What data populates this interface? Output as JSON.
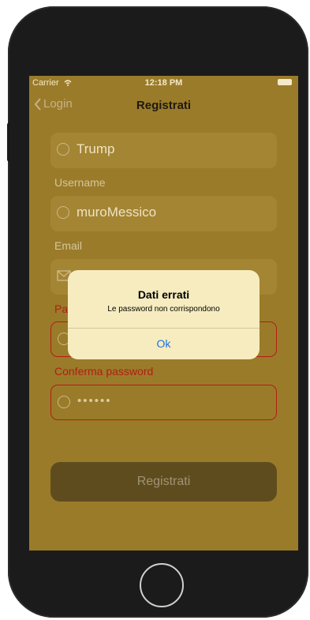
{
  "status": {
    "carrier": "Carrier",
    "time": "12:18 PM"
  },
  "nav": {
    "back_label": "Login",
    "title": "Registrati"
  },
  "fields": {
    "lastname_value": "Trump",
    "username_label": "Username",
    "username_value": "muroMessico",
    "email_label": "Email",
    "password_label": "Pa",
    "confirm_label": "Conferma password",
    "confirm_value": "••••••"
  },
  "register_button": "Registrati",
  "alert": {
    "title": "Dati errati",
    "message": "Le password non corrispondono",
    "ok_label": "Ok"
  },
  "colors": {
    "screen_bg": "#9a7b2a",
    "error_red": "#b21f13",
    "alert_bg": "#f6ecbf",
    "link_blue": "#1a73e8"
  }
}
